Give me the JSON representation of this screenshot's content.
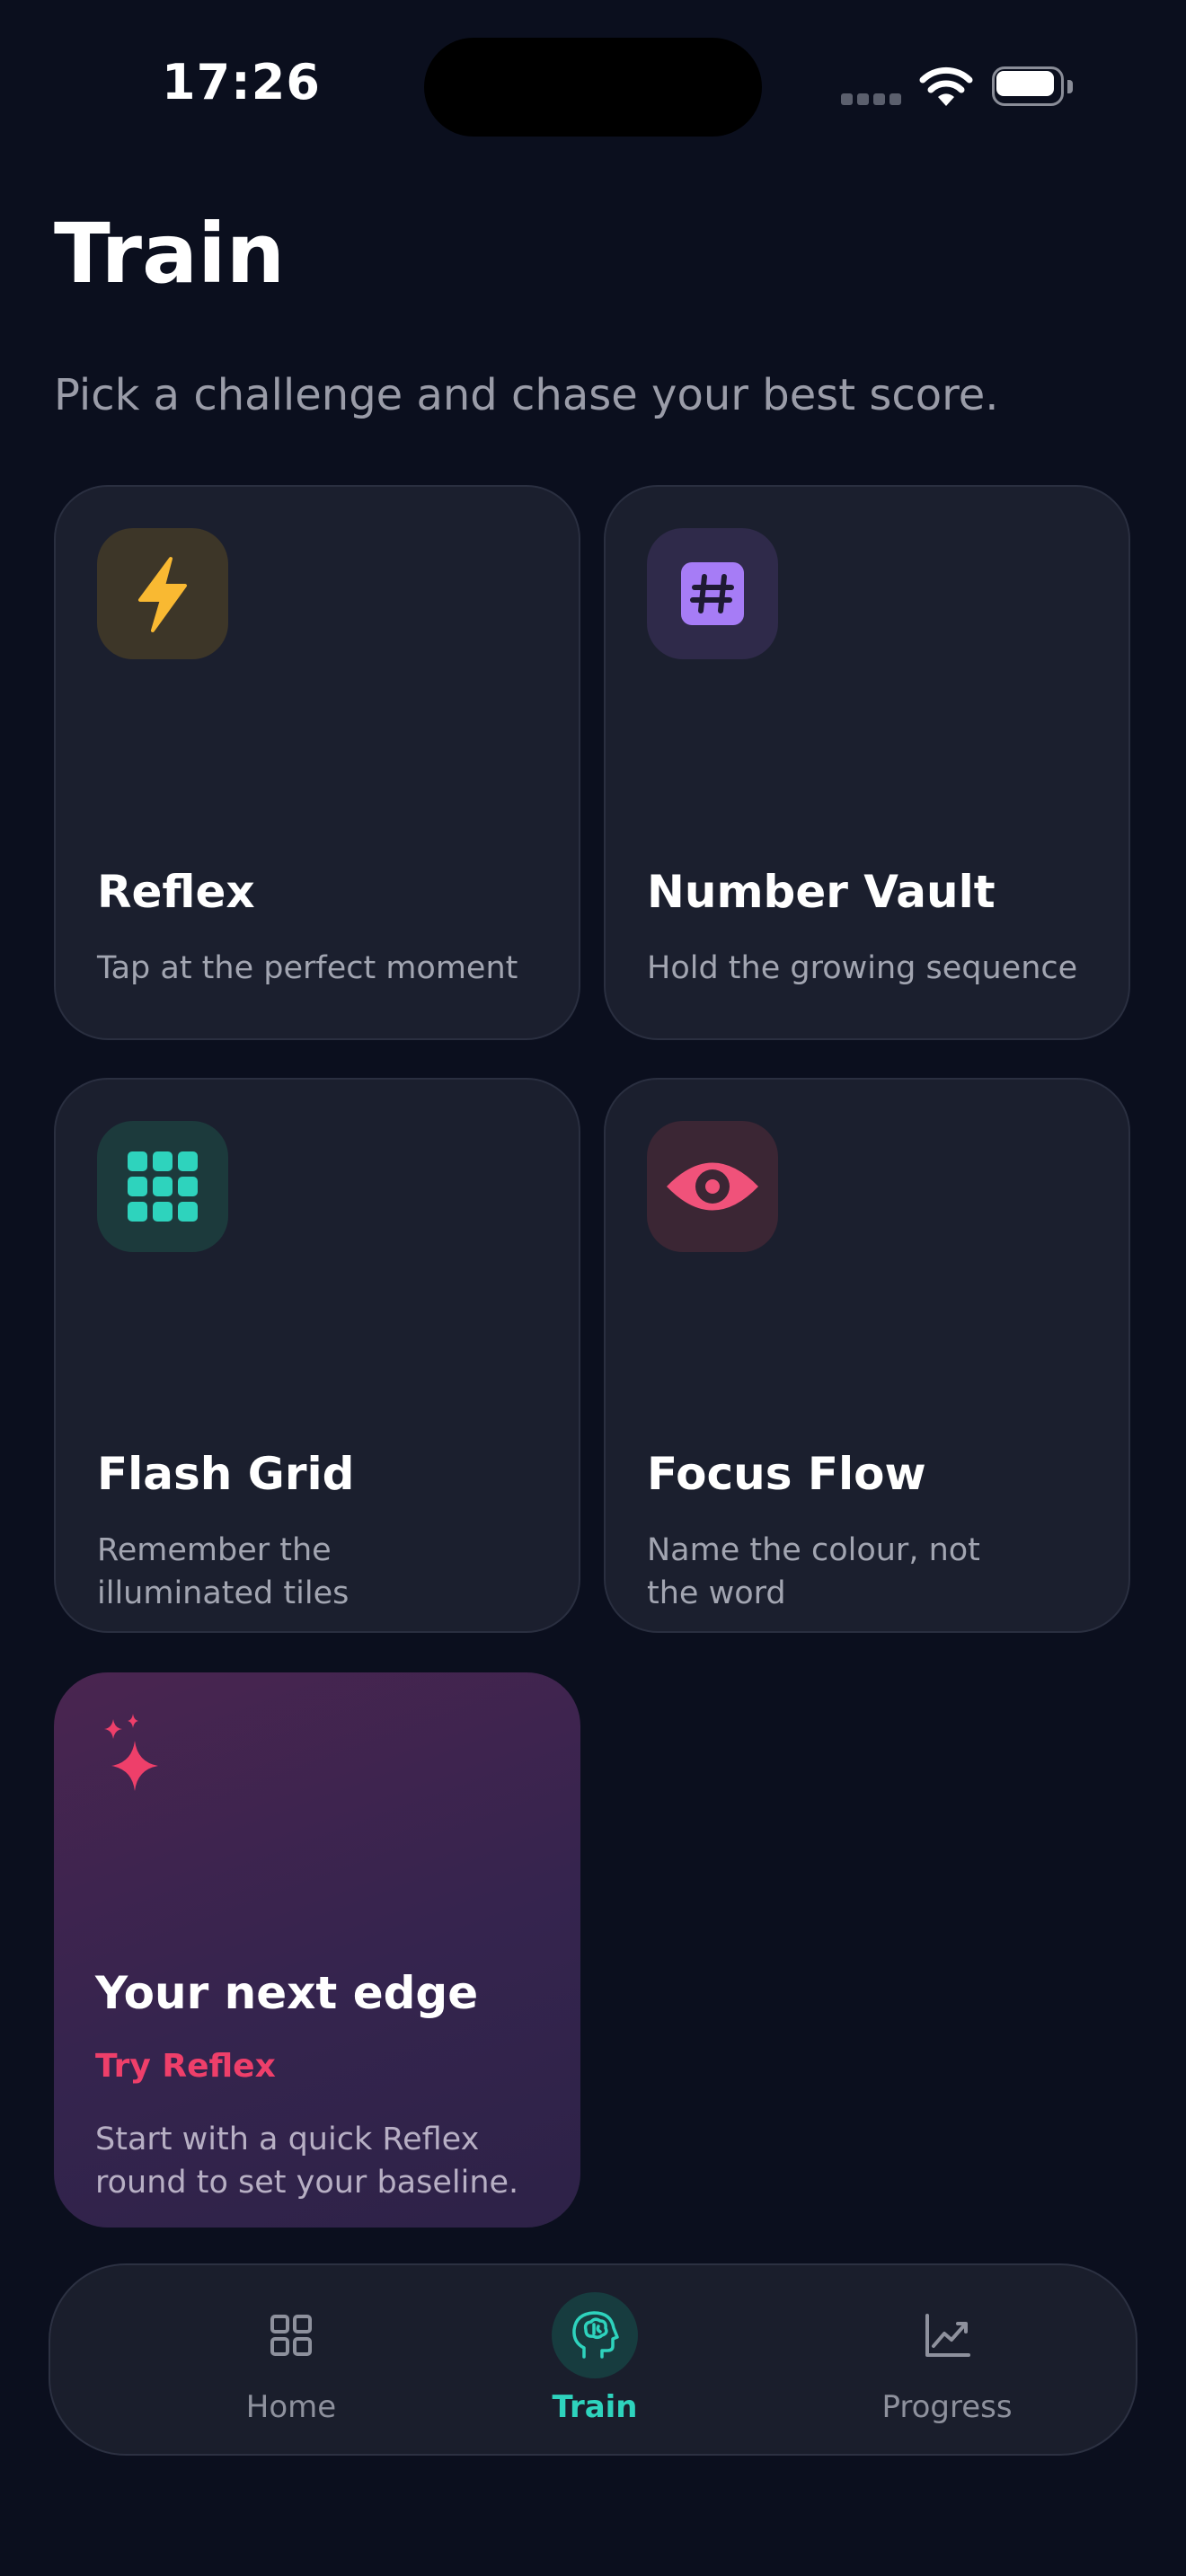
{
  "status_bar": {
    "time": "17:26"
  },
  "header": {
    "title": "Train",
    "subtitle": "Pick a challenge and chase your best score."
  },
  "cards": [
    {
      "id": "reflex",
      "title": "Reflex",
      "description": "Tap at the perfect moment",
      "icon": "lightning-bolt-icon",
      "accent": "#f9b932",
      "tile_color": "#3d3628"
    },
    {
      "id": "number-vault",
      "title": "Number Vault",
      "description": "Hold the growing sequence",
      "icon": "hash-icon",
      "accent": "#a67cf6",
      "tile_color": "#2f2a4a"
    },
    {
      "id": "flash-grid",
      "title": "Flash Grid",
      "description": "Remember the illuminated tiles",
      "icon": "grid-icon",
      "accent": "#2ed3bd",
      "tile_color": "#1c3a3c"
    },
    {
      "id": "focus-flow",
      "title": "Focus Flow",
      "description": "Name the colour, not the word",
      "icon": "eye-icon",
      "accent": "#f0527a",
      "tile_color": "#3b2634"
    }
  ],
  "suggestion": {
    "title": "Your next edge",
    "cta": "Try Reflex",
    "description": "Start with a quick Reflex round to set your baseline.",
    "icon": "sparkles-icon",
    "accent": "#ee3f6a"
  },
  "tab_bar": {
    "tabs": [
      {
        "id": "home",
        "label": "Home",
        "icon": "grid-2x2-icon",
        "active": false
      },
      {
        "id": "train",
        "label": "Train",
        "icon": "brain-head-icon",
        "active": true
      },
      {
        "id": "progress",
        "label": "Progress",
        "icon": "trend-chart-icon",
        "active": false
      }
    ],
    "active_color": "#2ed3bd"
  }
}
